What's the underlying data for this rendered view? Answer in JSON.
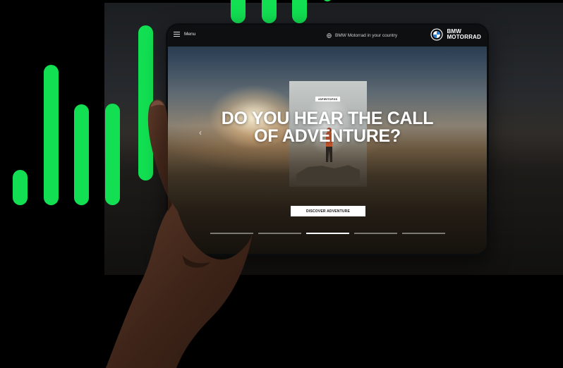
{
  "menu": {
    "label": "Menu",
    "icon": "hamburger-icon"
  },
  "topbar": {
    "country_link": "BMW Motorrad in your country",
    "country_icon": "globe-icon"
  },
  "brand": {
    "line1": "BMW",
    "line2": "MOTORRAD",
    "logo": "bmw-roundel-icon"
  },
  "hero": {
    "tag": "#SPIRITOFGS",
    "headline_line1": "DO YOU HEAR THE CALL",
    "headline_line2": "OF ADVENTURE?",
    "cta": "DISCOVER ADVENTURE",
    "prev_icon": "chevron-left-icon"
  },
  "carousel": {
    "slide_count": 5,
    "active_index": 2
  },
  "colors": {
    "accent_green": "#12e052",
    "topbar": "#0d0f11",
    "cta_bg": "#ffffff"
  }
}
